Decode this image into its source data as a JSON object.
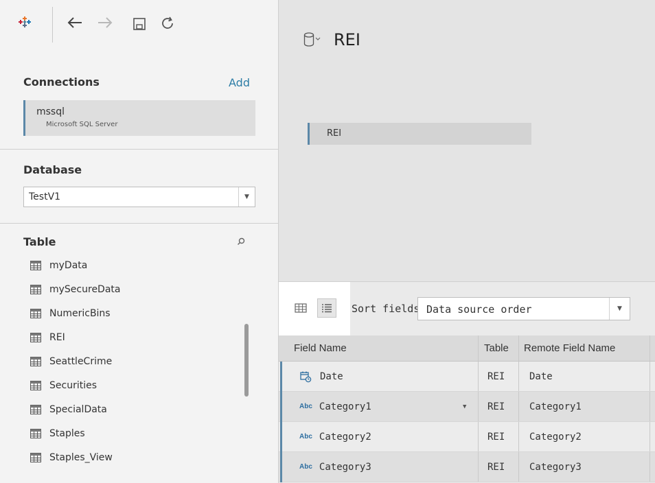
{
  "connections": {
    "title": "Connections",
    "add_label": "Add",
    "items": [
      {
        "name": "mssql",
        "type": "Microsoft SQL Server"
      }
    ]
  },
  "database": {
    "title": "Database",
    "selected": "TestV1"
  },
  "tables": {
    "title": "Table",
    "items": [
      {
        "label": "myData"
      },
      {
        "label": "mySecureData"
      },
      {
        "label": "NumericBins"
      },
      {
        "label": "REI"
      },
      {
        "label": "SeattleCrime"
      },
      {
        "label": "Securities"
      },
      {
        "label": "SpecialData"
      },
      {
        "label": "Staples"
      },
      {
        "label": "Staples_View"
      }
    ]
  },
  "canvas": {
    "datasource_name": "REI",
    "joined_table": "REI"
  },
  "preview": {
    "sort_label": "Sort fields",
    "sort_value": "Data source order",
    "columns": [
      "Field Name",
      "Table",
      "Remote Field Name"
    ],
    "rows": [
      {
        "type_icon": "calendar-clock-icon",
        "field": "Date",
        "table": "REI",
        "remote": "Date"
      },
      {
        "type_icon": "abc",
        "type_label": "Abc",
        "field": "Category1",
        "table": "REI",
        "remote": "Category1"
      },
      {
        "type_icon": "abc",
        "type_label": "Abc",
        "field": "Category2",
        "table": "REI",
        "remote": "Category2"
      },
      {
        "type_icon": "abc",
        "type_label": "Abc",
        "field": "Category3",
        "table": "REI",
        "remote": "Category3"
      }
    ]
  },
  "colors": {
    "accent": "#5b88a8",
    "link": "#2d7da6"
  }
}
